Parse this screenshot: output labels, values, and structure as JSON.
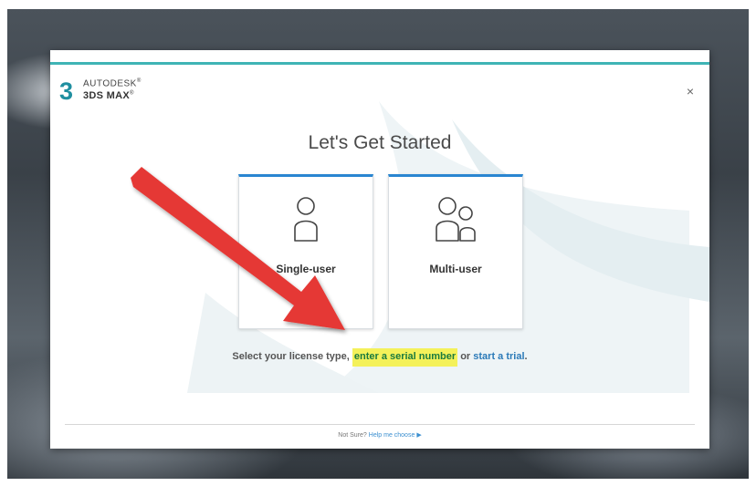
{
  "logo": {
    "number": "3",
    "brand": "AUTODESK",
    "product": "3DS MAX",
    "brand_mark": "®",
    "product_mark": "®"
  },
  "dialog": {
    "close_glyph": "×",
    "title": "Let's Get Started"
  },
  "cards": [
    {
      "label": "Single-user",
      "icon": "single-user-icon"
    },
    {
      "label": "Multi-user",
      "icon": "multi-user-icon"
    }
  ],
  "license": {
    "prefix": "Select your license type, ",
    "serial_link": "enter a serial number",
    "middle": " or ",
    "trial_link": "start a trial",
    "suffix": "."
  },
  "footer": {
    "prefix": "Not Sure? ",
    "help_link": "Help me choose",
    "arrow_glyph": "▶"
  },
  "colors": {
    "accent": "#3fb4b5",
    "card_top": "#2a86d1",
    "highlight": "#f4f15a",
    "annotation_arrow": "#e53935"
  }
}
